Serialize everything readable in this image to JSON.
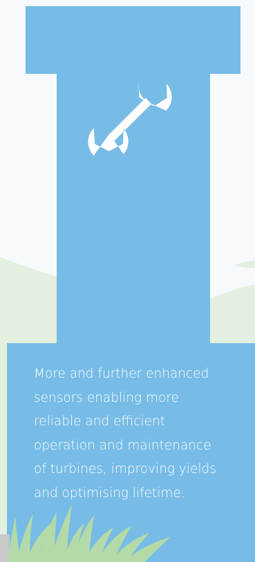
{
  "illustration": {
    "icon": "wrench-icon",
    "colors": {
      "background": "#f6fafd",
      "panel": "#77bce6",
      "hill": "#e3efdf",
      "grass": "#b4daa8",
      "ground": "#c8c8c8",
      "icon": "#ffffff",
      "text": "#ffffff"
    }
  },
  "caption": {
    "lines": [
      "More and further enhanced",
      "sensors enabling more",
      "reliable and efficient",
      "operation and maintenance",
      "of turbines, improving yields",
      "and optimising lifetime."
    ]
  }
}
